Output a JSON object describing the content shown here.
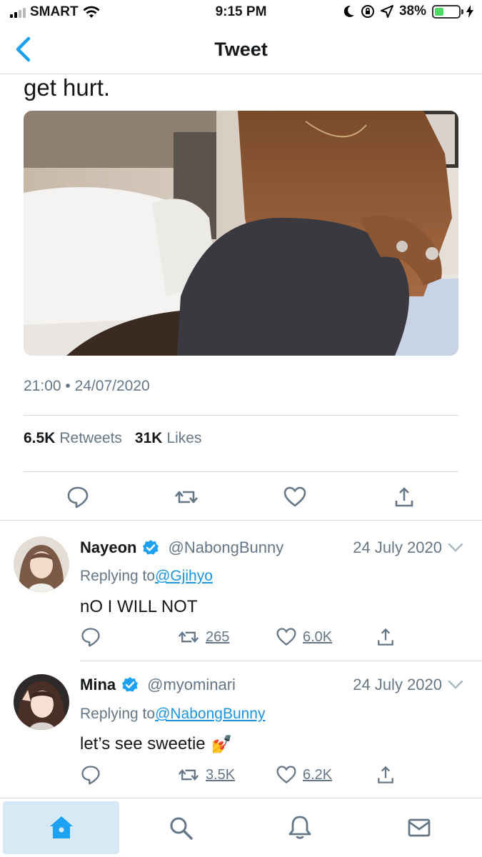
{
  "status_bar": {
    "carrier": "SMART",
    "time": "9:15 PM",
    "battery": "38%",
    "battery_level": 0.38
  },
  "nav": {
    "title": "Tweet"
  },
  "tweet": {
    "text": "get hurt.",
    "timestamp": "21:00 • 24/07/2020",
    "retweets_count": "6.5K",
    "retweets_label": "Retweets",
    "likes_count": "31K",
    "likes_label": "Likes"
  },
  "replies": [
    {
      "name": "Nayeon",
      "handle": "@NabongBunny",
      "date": "24 July 2020",
      "replying_prefix": "Replying to",
      "replying_to": "@Gjihyo",
      "text": "nO I WILL NOT",
      "emoji": "",
      "retweets": "265",
      "likes": "6.0K"
    },
    {
      "name": "Mina",
      "handle": "@myominari",
      "date": "24 July 2020",
      "replying_prefix": "Replying to",
      "replying_to": "@NabongBunny",
      "text": "let’s see sweetie",
      "emoji": "💅",
      "retweets": "3.5K",
      "likes": "6.2K"
    }
  ],
  "colors": {
    "accent": "#1da1f2",
    "secondary_text": "#657786",
    "divider": "#d6dadd",
    "active_tab_bg": "#d7e9f5"
  },
  "icons": {
    "back": "chevron-left-icon",
    "reply": "reply-icon",
    "retweet": "retweet-icon",
    "like": "heart-icon",
    "share": "share-icon",
    "verified": "verified-badge-icon",
    "home": "home-icon",
    "search": "search-icon",
    "notifications": "bell-icon",
    "messages": "mail-icon"
  }
}
